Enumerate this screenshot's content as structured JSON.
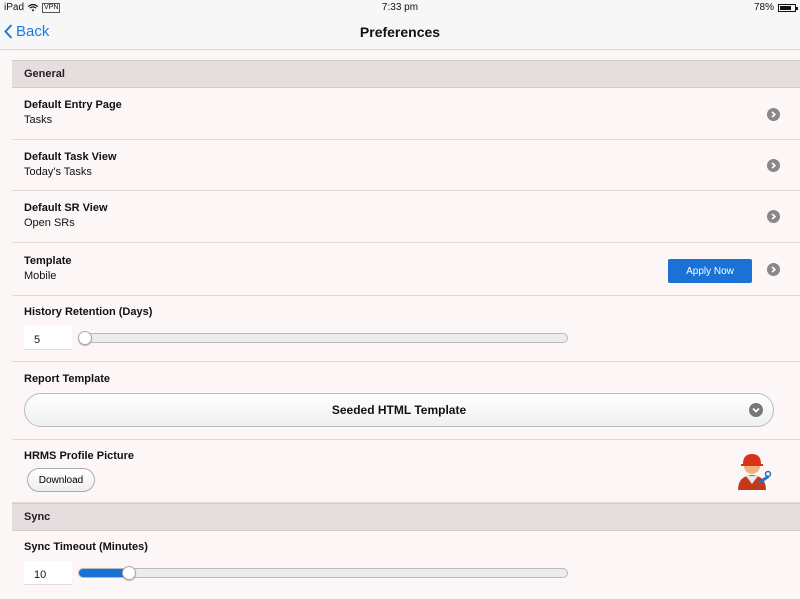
{
  "status_bar": {
    "device": "iPad",
    "vpn": "VPN",
    "time": "7:33 pm",
    "battery": "78%",
    "battery_level": 0.78
  },
  "nav": {
    "back_label": "Back",
    "title": "Preferences"
  },
  "general": {
    "header": "General",
    "default_entry_page": {
      "title": "Default Entry Page",
      "value": "Tasks"
    },
    "default_task_view": {
      "title": "Default Task View",
      "value": "Today's Tasks"
    },
    "default_sr_view": {
      "title": "Default SR View",
      "value": "Open SRs"
    },
    "template": {
      "title": "Template",
      "value": "Mobile",
      "button_label": "Apply Now"
    },
    "history_retention": {
      "title": "History Retention (Days)",
      "value": "5",
      "level": 0.0
    },
    "report_template": {
      "title": "Report Template",
      "selected": "Seeded HTML Template"
    },
    "hrms_profile_picture": {
      "title": "HRMS Profile Picture",
      "button_label": "Download"
    }
  },
  "sync": {
    "header": "Sync",
    "sync_timeout": {
      "title": "Sync Timeout (Minutes)",
      "value": "10",
      "level": 0.09
    }
  },
  "colors": {
    "accent": "#1a72d6",
    "link": "#1a7be0",
    "section_header_bg": "#e6dede",
    "row_bg": "#fdf6f6"
  }
}
